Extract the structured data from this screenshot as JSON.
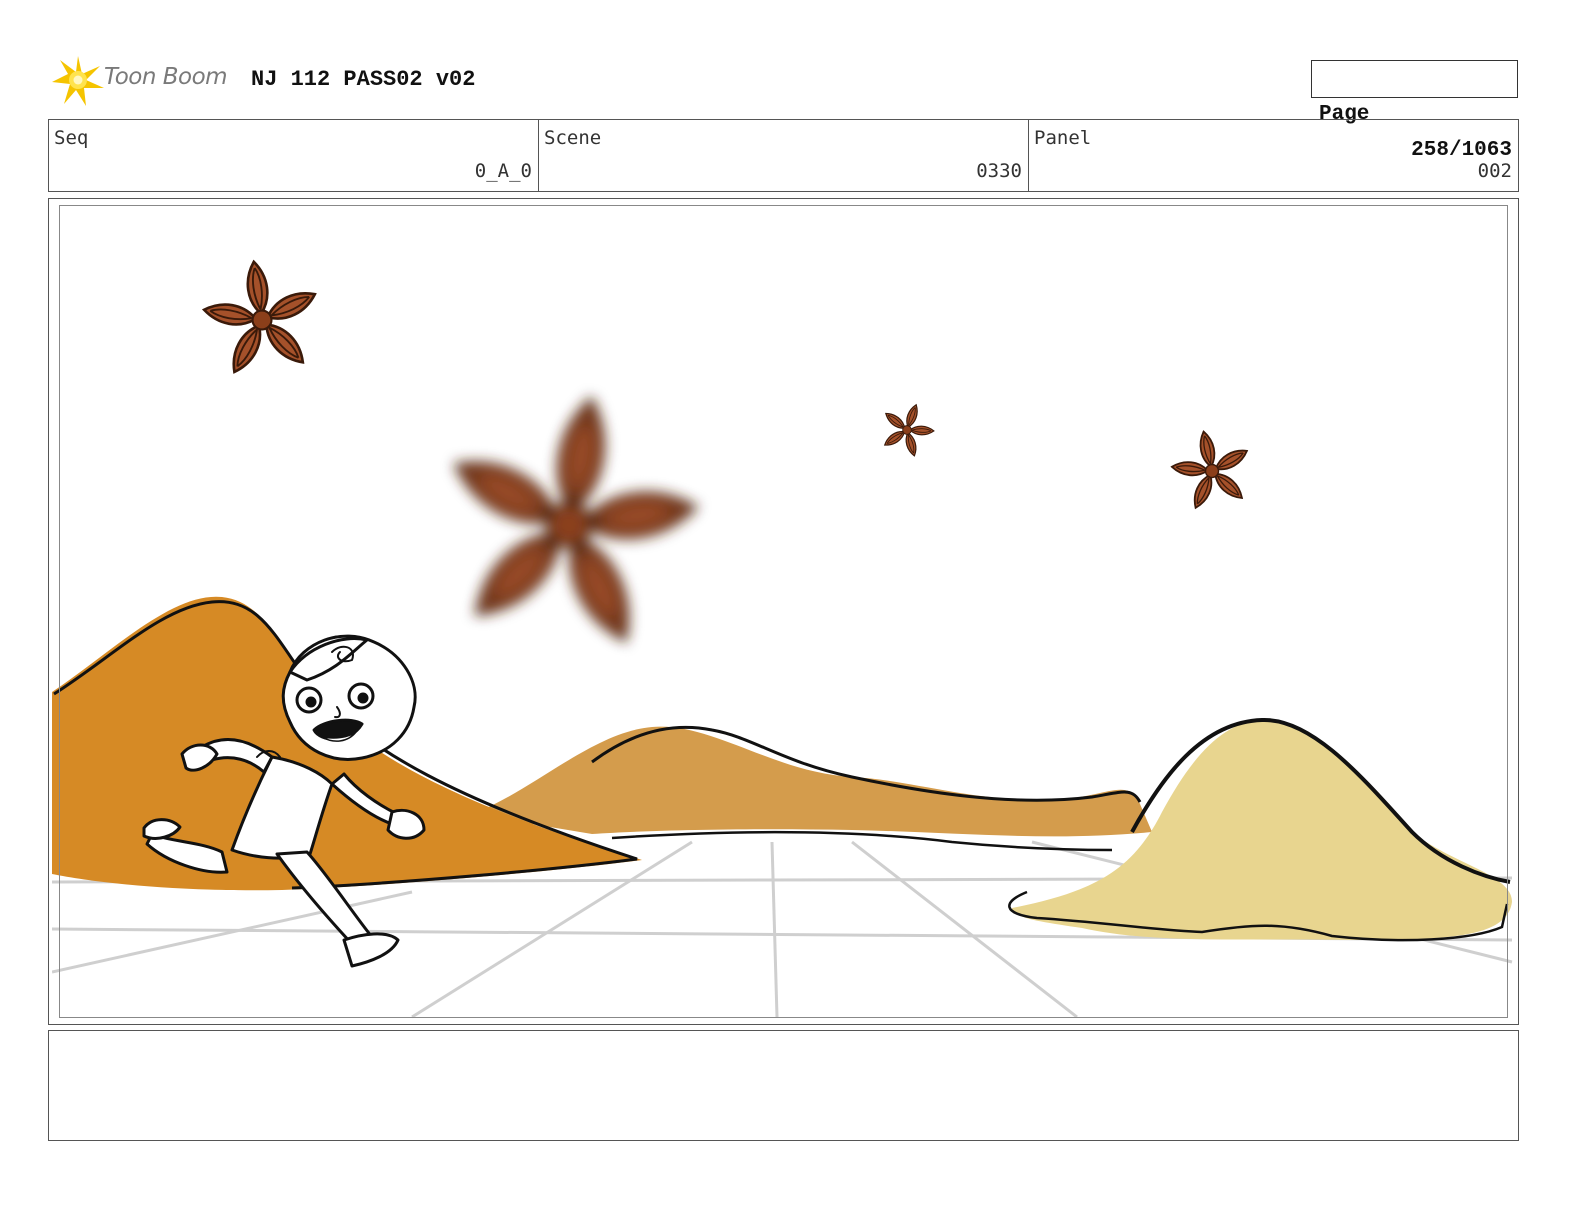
{
  "header": {
    "logo_text": "Toon Boom",
    "title": "NJ 112 PASS02 v02",
    "page_label": "Page",
    "page_value": "258/1063"
  },
  "info": {
    "seq_label": "Seq",
    "seq_value": "0_A_0",
    "scene_label": "Scene",
    "scene_value": "0330",
    "panel_label": "Panel",
    "panel_value": "002"
  },
  "panel_art": {
    "icons": [
      "toon-boom-logo-icon",
      "star-anise-icon",
      "running-child-figure",
      "spice-mound"
    ],
    "colors": {
      "star_anise": "#8b3f1a",
      "mound_left": "#d68a25",
      "mound_middle": "#d49c4c",
      "mound_right": "#e8d58f",
      "floor_grid": "#cfcfcf"
    }
  },
  "notes": {
    "text": ""
  }
}
